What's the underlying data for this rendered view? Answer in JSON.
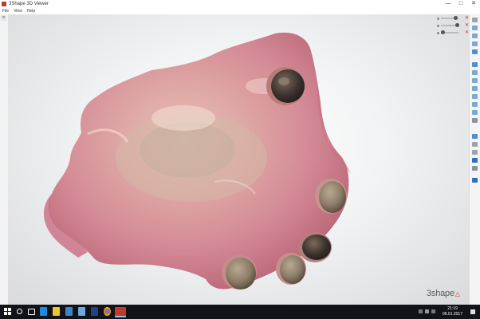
{
  "window": {
    "title": "3Shape 3D Viewer",
    "min": "—",
    "max": "□",
    "close": "✕"
  },
  "menu": {
    "items": [
      "File",
      "View",
      "Help"
    ]
  },
  "sidebar": {
    "collapse_glyph": "»"
  },
  "viewport": {
    "logo_text": "3shape",
    "logo_mark": "△"
  },
  "scene_panel": {
    "close_glyph": "✕"
  },
  "toolbar": {
    "tools": [
      "scale-icon",
      "cube-front-icon",
      "cube-back-icon",
      "cube-top-icon",
      "camera-icon",
      "view-layers-icon",
      "cube-left-icon",
      "cube-right-icon",
      "cube-iso-icon",
      "cube-bottom-icon",
      "cube-side-icon",
      "cube-rear-icon",
      "wrench-icon",
      "eye-icon",
      "section-icon",
      "measure-icon",
      "annotate-icon",
      "settings-icon",
      "ok-icon"
    ]
  },
  "taskbar": {
    "apps": [
      "search-icon",
      "task-view-icon",
      "edge-icon",
      "file-explorer-icon",
      "store-icon",
      "mail-icon",
      "app-icon",
      "chrome-icon",
      "viewer-icon"
    ],
    "time": "21:19",
    "date": "06.01.2017"
  },
  "colors": {
    "accent": "#c0392b",
    "taskbar": "#101418",
    "gum": "#d58d96"
  }
}
